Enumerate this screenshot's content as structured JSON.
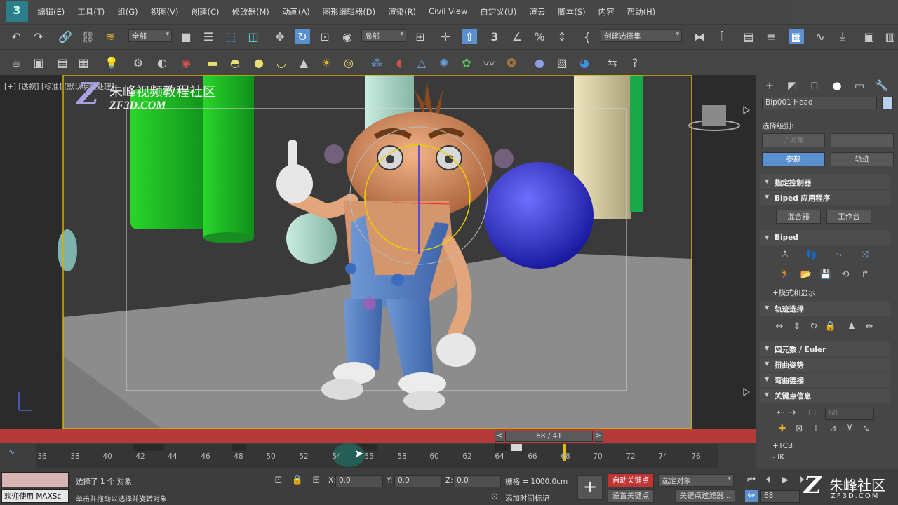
{
  "app": {
    "logo": "3"
  },
  "menu": [
    "编辑(E)",
    "工具(T)",
    "组(G)",
    "视图(V)",
    "创建(C)",
    "修改器(M)",
    "动画(A)",
    "图形编辑器(D)",
    "渲染(R)",
    "Civil View",
    "自定义(U)",
    "渲云",
    "脚本(S)",
    "内容",
    "帮助(H)"
  ],
  "toolbar": {
    "filter_dropdown": "全部",
    "coord_dropdown": "局部",
    "selection_set_dropdown": "创建选择集",
    "snap_angle_label": "3",
    "icons": [
      "undo-icon",
      "redo-icon",
      "link-icon",
      "unlink-icon",
      "bind-space-warp-icon",
      "select-object-icon",
      "select-by-name-icon",
      "rect-selection-icon",
      "window-crossing-icon",
      "move-icon",
      "rotate-icon",
      "scale-icon",
      "placement-icon",
      "pivot-icon",
      "manipulate-icon",
      "keyboard-shortcut-icon",
      "snap-icon",
      "angle-snap-icon",
      "percent-snap-icon",
      "spinner-snap-icon",
      "edit-named-sets-icon",
      "mirror-icon",
      "align-icon",
      "layer-manager-icon",
      "scene-explorer-icon",
      "toggle-ribbon-icon",
      "curve-editor-icon",
      "schematic-view-icon",
      "material-editor-icon",
      "render-setup-icon"
    ]
  },
  "viewport": {
    "label": "[+] [透视] [标准] [默认明暗处理]",
    "watermark_cn": "朱峰视频教程社区",
    "watermark_en": "ZF3D.COM",
    "watermark_z": "Z"
  },
  "time_slider": {
    "label": "68 / 41",
    "prev": "<",
    "next": ">"
  },
  "ruler_ticks": [
    "36",
    "38",
    "40",
    "42",
    "44",
    "46",
    "48",
    "50",
    "52",
    "54",
    "55",
    "58",
    "60",
    "62",
    "64",
    "66",
    "68",
    "70",
    "72",
    "74",
    "76"
  ],
  "command_panel": {
    "object_name": "Bip001 Head",
    "selection_level_label": "选择级别:",
    "sub_object_button": "子对象",
    "params_button": "参数",
    "track_button": "轨迹",
    "sections": {
      "assign_controller": "指定控制器",
      "biped_apps": "Biped 应用程序",
      "mixer_button": "混合器",
      "workbench_button": "工作台",
      "biped": "Biped",
      "modes_and_display": "+模式和显示",
      "track_selection": "轨迹选择",
      "quaternion_euler": "四元数 / Euler",
      "twist_poses": "扭曲姿势",
      "bend_links": "弯曲链接",
      "key_info": "关键点信息",
      "key_info_frame": "13",
      "key_info_value": "68",
      "tcb": "+TCB",
      "ik": "- IK"
    }
  },
  "status": {
    "maxscript_label": "欢迎使用 MAXSc",
    "selected_text": "选择了 1 个 对象",
    "prompt_text": "单击并拖动以选择并旋转对象",
    "x_label": "X:",
    "x_value": "0.0",
    "y_label": "Y:",
    "y_value": "0.0",
    "z_label": "Z:",
    "z_value": "0.0",
    "grid_text": "栅格 = 1000.0cm",
    "add_time_tag": "添加时间标记",
    "auto_key_button": "自动关键点",
    "selected_object_dropdown": "选定对象",
    "set_key_button": "设置关键点",
    "key_filters_button": "关键点过滤器...",
    "current_frame": "68"
  },
  "corner_watermark": {
    "logo": "Z",
    "cn": "朱峰社区",
    "en": "ZF3D.COM"
  },
  "colors": {
    "time_bar": "#b53a3a",
    "auto_key": "#c23333",
    "params_button": "#5a8fd0",
    "viewport_border": "#d4b000"
  }
}
